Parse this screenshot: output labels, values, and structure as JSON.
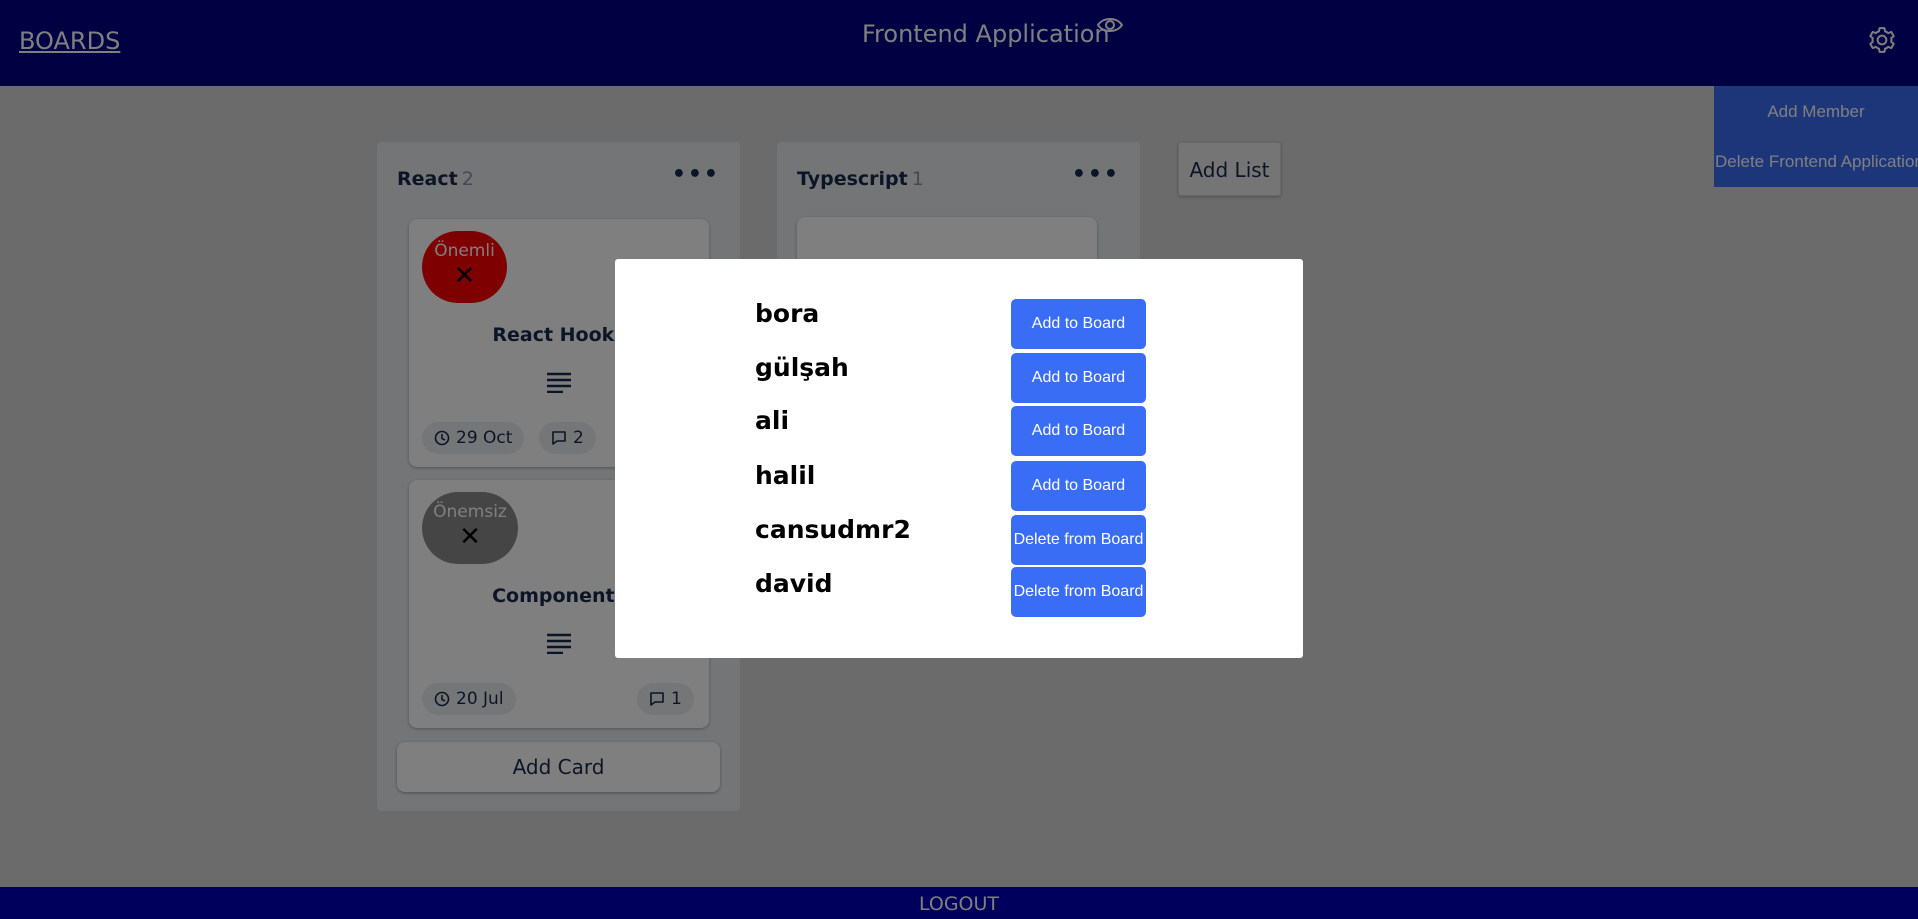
{
  "header": {
    "boards_link": "BOARDS",
    "board_title": "Frontend Application",
    "eye_icon": "eye-icon",
    "settings_icon": "gear-icon"
  },
  "board_menu": {
    "add_member": "Add Member",
    "delete_board": "Delete Frontend Application"
  },
  "lists": [
    {
      "title": "React",
      "count": "2",
      "menu_icon": "more-dots-icon",
      "cards": [
        {
          "label": "Önemli",
          "label_color": "#ff0000",
          "title": "React Hooks",
          "date": "29 Oct",
          "comments": "2"
        },
        {
          "label": "Önemsiz",
          "label_color": "#8a8a8a",
          "title": "Components",
          "date": "20 Jul",
          "comments": "1"
        }
      ],
      "add_card": "Add Card"
    },
    {
      "title": "Typescript",
      "count": "1",
      "menu_icon": "more-dots-icon"
    }
  ],
  "add_list": "Add List",
  "footer": {
    "logout": "LOGOUT"
  },
  "modal": {
    "members": [
      {
        "name": "bora",
        "action": "Add to Board"
      },
      {
        "name": "gülşah",
        "action": "Add to Board"
      },
      {
        "name": "ali",
        "action": "Add to Board"
      },
      {
        "name": "halil",
        "action": "Add to Board"
      },
      {
        "name": "cansudmr2",
        "action": "Delete from Board"
      },
      {
        "name": "david",
        "action": "Delete from Board"
      }
    ]
  },
  "colors": {
    "header_bg": "#000085",
    "footer_bg": "#0000b8",
    "accent_button": "#3a6df5",
    "important_label": "#ff0000",
    "unimportant_label": "#8a8a8a"
  }
}
